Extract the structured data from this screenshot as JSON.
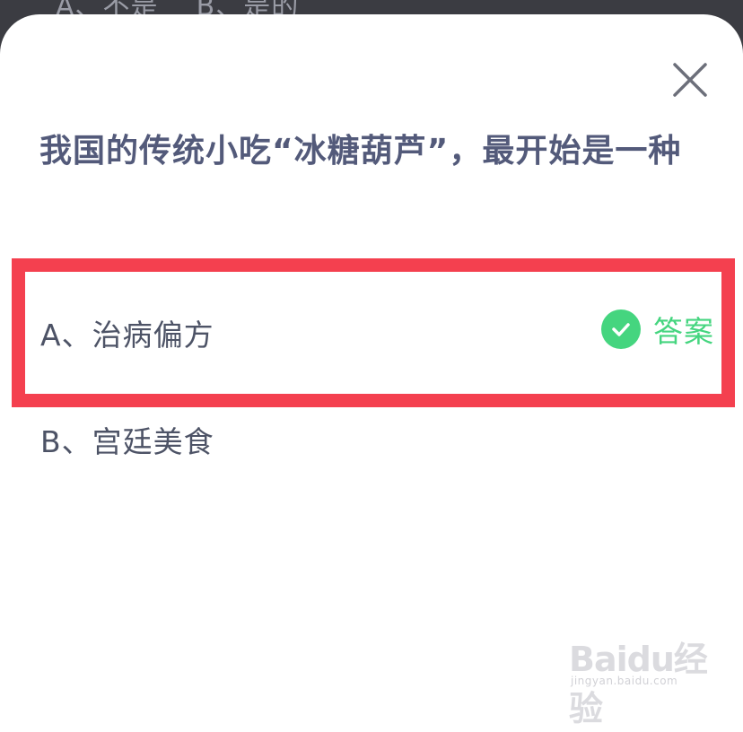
{
  "background": {
    "obscured_text": "A、不是    B、是的"
  },
  "quiz": {
    "question": "我国的传统小吃“冰糖葫芦”，最开始是一种",
    "options": [
      {
        "label": "A、治病偏方",
        "is_answer": true
      },
      {
        "label": "B、宫廷美食",
        "is_answer": false
      }
    ],
    "answer_tag": "答案"
  },
  "watermark": {
    "logo": "Baidu经验",
    "url": "jingyan.baidu.com"
  },
  "colors": {
    "highlight_border": "#f4404f",
    "answer_green": "#45d57f",
    "question_text": "#535a7a",
    "option_text": "#4d5366"
  }
}
